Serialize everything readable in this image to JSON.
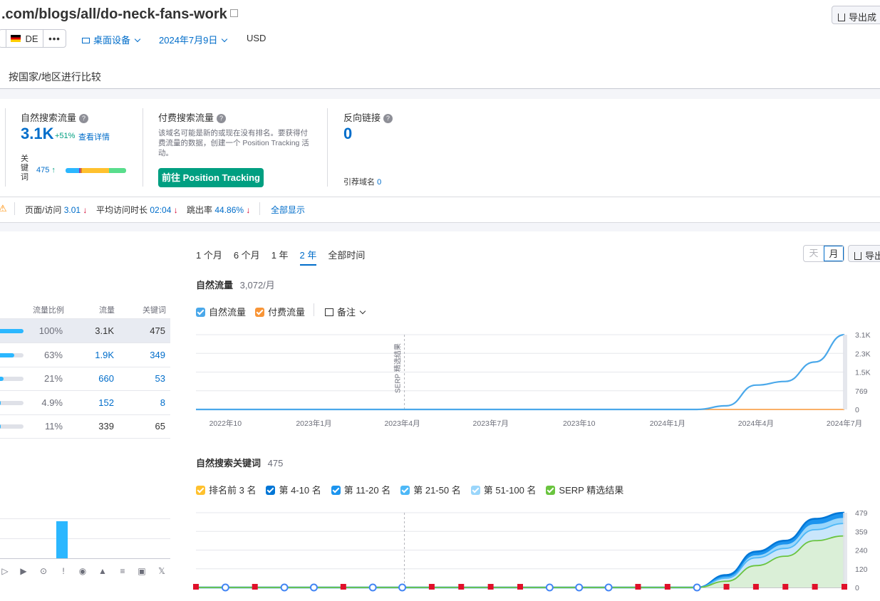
{
  "header": {
    "url": ".com/blogs/all/do-neck-fans-work",
    "export_label": "导出成",
    "country_code": "DE",
    "device_label": "桌面设备",
    "date_label": "2024年7月9日",
    "currency": "USD",
    "compare_label": "按国家/地区进行比较"
  },
  "organic": {
    "title": "自然搜索流量",
    "value": "3.1K",
    "change": "+51%",
    "details_link": "查看详情",
    "keywords_label": "关键词",
    "keywords_value": "475",
    "keywords_arrow": "↑"
  },
  "paid": {
    "title": "付费搜索流量",
    "description": "该域名可能是新的或现在没有排名。要获得付费流量的数据，创建一个 Position Tracking 活动。",
    "button": "前往 Position Tracking"
  },
  "backlinks": {
    "title": "反向链接",
    "value": "0",
    "ref_domains_label": "引荐域名",
    "ref_domains_value": "0"
  },
  "metrics_bar": {
    "warning": "⚠",
    "pages_label": "页面/访问",
    "pages_value": "3.01",
    "duration_label": "平均访问时长",
    "duration_value": "02:04",
    "bounce_label": "跳出率",
    "bounce_value": "44.86%",
    "show_all": "全部显示",
    "down_arrow": "↓"
  },
  "dist_table": {
    "headers": [
      "流量比例",
      "流量",
      "关键词"
    ],
    "rows": [
      {
        "share": "100%",
        "traffic": "3.1K",
        "keywords": "475",
        "fill": 1.0
      },
      {
        "share": "63%",
        "traffic": "1.9K",
        "keywords": "349",
        "fill": 0.63
      },
      {
        "share": "21%",
        "traffic": "660",
        "keywords": "53",
        "fill": 0.21
      },
      {
        "share": "4.9%",
        "traffic": "152",
        "keywords": "8",
        "fill": 0.049
      },
      {
        "share": "11%",
        "traffic": "339",
        "keywords": "65",
        "fill": 0.11
      }
    ]
  },
  "periods": [
    "1 个月",
    "6 个月",
    "1 年",
    "2 年",
    "全部时间"
  ],
  "active_period": "2 年",
  "granularity": {
    "day": "天",
    "month": "月"
  },
  "export_label": "导出",
  "traffic_chart": {
    "title": "自然流量",
    "value": "3,072/月",
    "legend_organic": "自然流量",
    "legend_paid": "付费流量",
    "notes_label": "备注",
    "serp_annotation": "SERP 精选结果"
  },
  "keywords_chart": {
    "title": "自然搜索关键词",
    "count": "475",
    "legend": [
      "排名前 3 名",
      "第 4-10 名",
      "第 11-20 名",
      "第 21-50 名",
      "第 51-100 名",
      "SERP 精选结果"
    ]
  },
  "colors": {
    "top3": "#ffc12e",
    "p4_10": "#0076d6",
    "p11_20": "#1c94ee",
    "p21_50": "#4db8f7",
    "p51_100": "#9ad6fb",
    "serp": "#6ac43f",
    "organic": "#4aa8ea",
    "paid": "#f89537"
  },
  "chart_data": [
    {
      "type": "line",
      "title": "自然流量",
      "x": [
        "2022年9",
        "2022年10",
        "2022年11",
        "2022年12",
        "2023年1",
        "2023年2",
        "2023年3",
        "2023年4",
        "2023年5",
        "2023年6",
        "2023年7",
        "2023年8",
        "2023年9",
        "2023年10",
        "2023年11",
        "2023年12",
        "2024年1",
        "2024年2",
        "2024年3",
        "2024年4",
        "2024年5",
        "2024年6",
        "2024年7"
      ],
      "series": [
        {
          "name": "自然流量",
          "values": [
            0,
            0,
            0,
            0,
            0,
            0,
            0,
            0,
            0,
            0,
            0,
            0,
            0,
            0,
            0,
            0,
            0,
            0,
            150,
            1000,
            1150,
            1950,
            3072
          ]
        },
        {
          "name": "付费流量",
          "values": [
            0,
            0,
            0,
            0,
            0,
            0,
            0,
            0,
            0,
            0,
            0,
            0,
            0,
            0,
            0,
            0,
            0,
            0,
            0,
            0,
            0,
            0,
            0
          ]
        }
      ],
      "x_tick_labels": [
        "2022年10",
        "2023年1月",
        "2023年4月",
        "2023年7月",
        "2023年10",
        "2024年1月",
        "2024年4月",
        "2024年7月"
      ],
      "y_tick_labels": [
        "0",
        "769",
        "1.5K",
        "2.3K",
        "3.1K"
      ],
      "ylim": [
        0,
        3072
      ],
      "annotation": "SERP 精选结果"
    },
    {
      "type": "area",
      "title": "自然搜索关键词",
      "x": [
        "2022年9",
        "2022年10",
        "2022年11",
        "2022年12",
        "2023年1",
        "2023年2",
        "2023年3",
        "2023年4",
        "2023年5",
        "2023年6",
        "2023年7",
        "2023年8",
        "2023年9",
        "2023年10",
        "2023年11",
        "2023年12",
        "2024年1",
        "2024年2",
        "2024年3",
        "2024年4",
        "2024年5",
        "2024年6",
        "2024年7"
      ],
      "series": [
        {
          "name": "第 4-10 名",
          "values": [
            0,
            0,
            0,
            0,
            0,
            0,
            0,
            0,
            0,
            0,
            0,
            0,
            0,
            0,
            0,
            0,
            0,
            0,
            80,
            230,
            300,
            440,
            479
          ]
        },
        {
          "name": "第 11-20 名",
          "values": [
            0,
            0,
            0,
            0,
            0,
            0,
            0,
            0,
            0,
            0,
            0,
            0,
            0,
            0,
            0,
            0,
            0,
            0,
            70,
            210,
            280,
            410,
            450
          ]
        },
        {
          "name": "第 21-50 名",
          "values": [
            0,
            0,
            0,
            0,
            0,
            0,
            0,
            0,
            0,
            0,
            0,
            0,
            0,
            0,
            0,
            0,
            0,
            0,
            60,
            190,
            250,
            370,
            410
          ]
        },
        {
          "name": "SERP 精选结果",
          "values": [
            0,
            0,
            0,
            0,
            0,
            0,
            0,
            0,
            0,
            0,
            0,
            0,
            0,
            0,
            0,
            0,
            0,
            0,
            40,
            140,
            200,
            300,
            330
          ]
        }
      ],
      "y_tick_labels": [
        "0",
        "120",
        "240",
        "359",
        "479"
      ],
      "ylim": [
        0,
        479
      ]
    }
  ]
}
